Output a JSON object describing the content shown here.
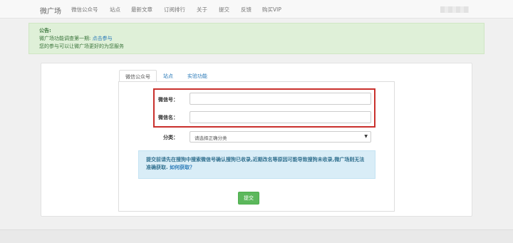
{
  "navbar": {
    "brand": "微广场",
    "items": [
      "微信公众号",
      "站点",
      "最新文章",
      "订阅排行",
      "关于",
      "提交",
      "反馈",
      "购买VIP"
    ]
  },
  "notice": {
    "title": "公告:",
    "line1_prefix": "微广场功能调查第一期: ",
    "line1_link": "点击参与",
    "line2": "您的参与可以让微广场更好的为您服务"
  },
  "tabs": [
    "微信公众号",
    "站点",
    "实验功能"
  ],
  "form": {
    "wechat_id_label": "微信号：",
    "wechat_name_label": "微信名：",
    "category_label": "分类：",
    "category_selected": "请选择正确分类",
    "info_text": "提交前请先在搜狗中搜索微信号确认搜狗已收录,近期改名等原因可能导致搜狗未收录,微广场则无法准确获取. ",
    "info_link": "如何获取？",
    "submit_label": "提交"
  },
  "colors": {
    "highlight_border": "#c9302c",
    "submit_bg": "#5cb85c",
    "notice_bg": "#dff0d8",
    "info_bg": "#d9edf7"
  }
}
